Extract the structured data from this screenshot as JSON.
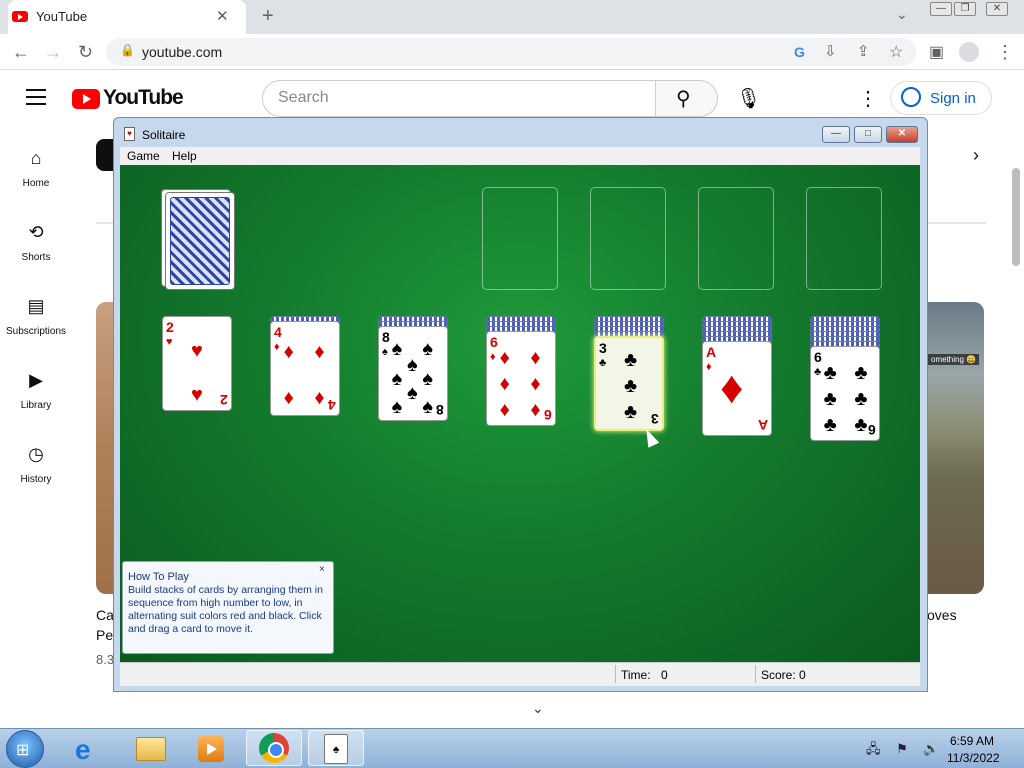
{
  "browser": {
    "tab_title": "YouTube",
    "tab_close": "✕",
    "new_tab": "+",
    "tab_dropdown": "⌄",
    "url": "youtube.com",
    "icons": [
      "back-icon",
      "forward-icon",
      "reload-icon",
      "lock-icon",
      "google-icon",
      "install-icon",
      "share-icon",
      "bookmark-star-icon",
      "side-panel-icon",
      "profile-icon",
      "menu-dots-icon"
    ],
    "window_buttons": [
      "—",
      "❐",
      "✕"
    ]
  },
  "youtube": {
    "logo_text": "YouTube",
    "search_placeholder": "Search",
    "sign_in": "Sign in",
    "nav": [
      {
        "label": "Home",
        "icon": "⌂"
      },
      {
        "label": "Shorts",
        "icon": "⟲"
      },
      {
        "label": "Subscriptions",
        "icon": "▤"
      },
      {
        "label": "Library",
        "icon": "▶"
      },
      {
        "label": "History",
        "icon": "◷"
      }
    ],
    "left_video": {
      "title_line1": "Ca",
      "title_line2": "Pe",
      "views": "8.3"
    },
    "right_video": {
      "title": "oves",
      "caption": "omething 😄"
    }
  },
  "solitaire": {
    "title": "Solitaire",
    "menu": [
      "Game",
      "Help"
    ],
    "caption_buttons": [
      "—",
      "□",
      "✕"
    ],
    "status": {
      "time_label": "Time:",
      "time_value": "0",
      "score": "Score: 0"
    },
    "tableau": [
      {
        "rank": "2",
        "suit": "♥",
        "color": "red"
      },
      {
        "rank": "4",
        "suit": "♦",
        "color": "red"
      },
      {
        "rank": "8",
        "suit": "♠",
        "color": "black"
      },
      {
        "rank": "6",
        "suit": "♦",
        "color": "red"
      },
      {
        "rank": "3",
        "suit": "♣",
        "color": "black",
        "selected": true
      },
      {
        "rank": "A",
        "suit": "♦",
        "color": "red"
      },
      {
        "rank": "6",
        "suit": "♣",
        "color": "black"
      }
    ],
    "face_down_counts": [
      0,
      1,
      2,
      3,
      4,
      5,
      6
    ],
    "how_to_play": {
      "title": "How To Play",
      "text": "Build stacks of cards by arranging them in sequence from high number to low, in alternating suit colors red and black. Click and drag a card to move it.",
      "close": "×"
    }
  },
  "taskbar": {
    "clock_time": "6:59 AM",
    "clock_date": "11/3/2022",
    "tray": "🖧 ⚑ 🔊"
  }
}
